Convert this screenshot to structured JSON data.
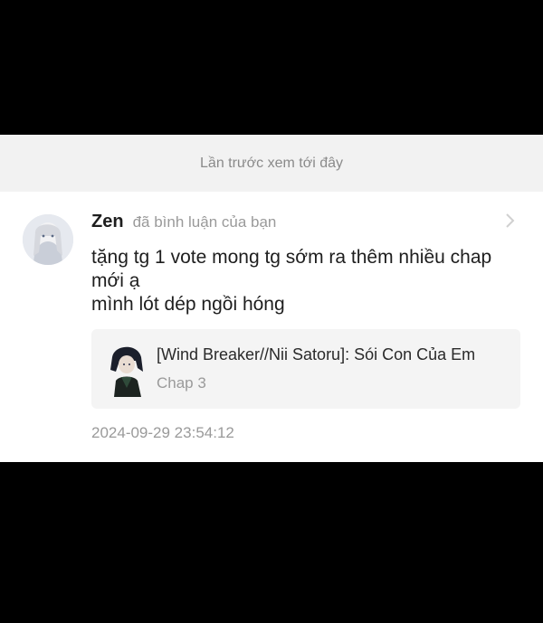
{
  "last_read_banner": "Lần trước xem tới đây",
  "comment": {
    "user_name": "Zen",
    "action_text": "đã bình luận của bạn",
    "text_lines": [
      "tặng tg 1 vote mong tg sớm ra thêm nhiều chap",
      "mới ạ",
      "mình lót dép ngồi hóng"
    ],
    "story": {
      "title": "[Wind Breaker//Nii Satoru]: Sói Con Của Em",
      "chapter": "Chap 3"
    },
    "timestamp": "2024-09-29 23:54:12"
  },
  "icons": {
    "avatar": "avatar-image",
    "cover": "story-cover-image",
    "chevron": "chevron-right-icon"
  },
  "colors": {
    "banner_bg": "#f2f2f2",
    "muted_text": "#9a9a9a",
    "primary_text": "#1e1e1e",
    "story_card_bg": "#f4f4f4"
  }
}
